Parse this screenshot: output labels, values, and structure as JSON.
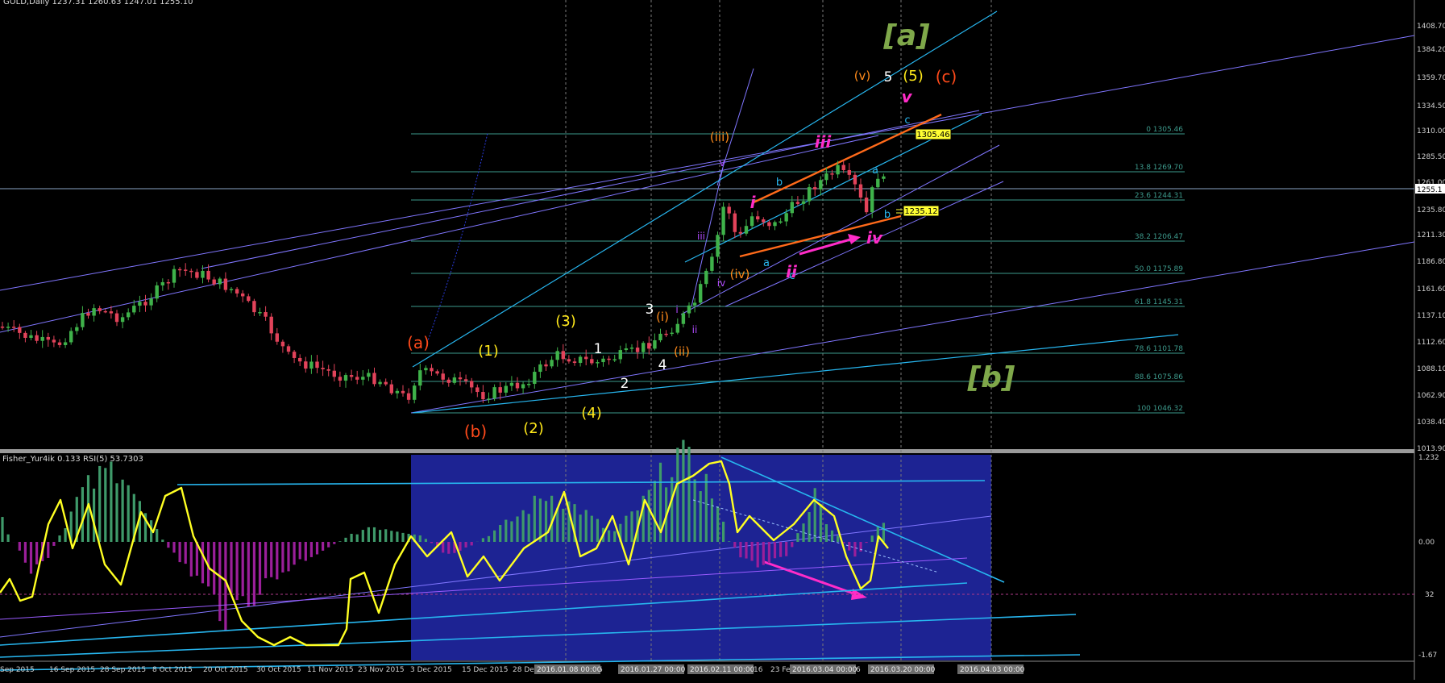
{
  "header": {
    "main_title": "GOLD,Daily 1237.31 1260.63 1247.01 1255.10",
    "indicator_title": "Fisher_Yur4ik 0.133 RSI(5) 53.7303"
  },
  "colors": {
    "background": "#000000",
    "bull_candle": "#3fb24a",
    "bear_candle": "#e2435a",
    "blue_box": "#1f26a0",
    "yellow_line": "#ffff22",
    "cyan_line": "#27b6ef",
    "violet_line": "#8076ff",
    "orange_line": "#ff6a1a",
    "magenta": "#ff2cc8",
    "fib_line": "#3d9a8c"
  },
  "price_axis": {
    "ticks": [
      "1408.70",
      "1384.20",
      "1359.70",
      "1334.50",
      "1310.00",
      "1285.50",
      "1261.00",
      "1235.80",
      "1211.30",
      "1186.80",
      "1161.60",
      "1137.10",
      "1112.60",
      "1088.10",
      "1062.90",
      "1038.40",
      "1013.90"
    ],
    "current_price": "1255.1"
  },
  "indicator_axis": {
    "ticks": [
      "1.232",
      "0.00",
      "32",
      "-1.67"
    ]
  },
  "time_axis": {
    "labels": [
      "Sep 2015",
      "16 Sep 2015",
      "28 Sep 2015",
      "8 Oct 2015",
      "20 Oct 2015",
      "30 Oct 2015",
      "11 Nov 2015",
      "23 Nov 2015",
      "3 Dec 2015",
      "15 Dec 2015",
      "28 De",
      "6",
      "16",
      "23 Fe",
      "6"
    ],
    "stamps": [
      "2016.01.08 00:00",
      "2016.01.27 00:00",
      "2016.02.11 00:00",
      "2016.03.04 00:00",
      "2016.03.20 00:00",
      "2016.04.03 00:00"
    ]
  },
  "fib_levels": [
    {
      "label": "0 1305.46"
    },
    {
      "label": "13.8 1269.70"
    },
    {
      "label": "23.6 1244.31"
    },
    {
      "label": "38.2 1206.47"
    },
    {
      "label": "50.0 1175.89"
    },
    {
      "label": "61.8 1145.31"
    },
    {
      "label": "78.6 1101.78"
    },
    {
      "label": "88.6 1075.86"
    },
    {
      "label": "100 1046.32"
    }
  ],
  "price_boxes": [
    "1305.46",
    "1235.12"
  ],
  "wave_labels": {
    "big_a": "[a]",
    "big_b": "[b]",
    "a_paren": "(a)",
    "b_paren": "(b)",
    "c_paren": "(c)",
    "w1": "(1)",
    "w2": "(2)",
    "w3": "(3)",
    "w4": "(4)",
    "w5": "(5)",
    "n1": "1",
    "n2": "2",
    "n3": "3",
    "n4": "4",
    "n5": "5",
    "ri": "(i)",
    "rii": "(ii)",
    "riii": "(iii)",
    "riv": "(iv)",
    "rv": "(v)",
    "mi": "i",
    "mii": "ii",
    "miii": "iii",
    "miv": "iv",
    "mv": "v",
    "pi": "i",
    "pii": "ii",
    "piii": "iii",
    "piv": "iv",
    "pv": "v",
    "la": "a",
    "lb": "b",
    "lc": "c",
    "la2": "a",
    "lb2": "b",
    "lc2": "c"
  }
}
